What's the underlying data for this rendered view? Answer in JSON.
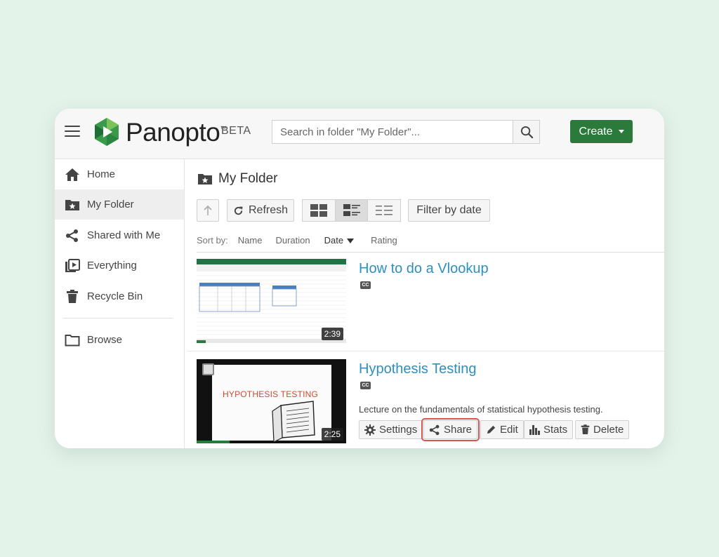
{
  "app": {
    "name": "Panopto",
    "trademark": "™",
    "badge": "BETA"
  },
  "colors": {
    "accent": "#2b7a3c",
    "link": "#2e8fbf",
    "highlight": "#d9534f"
  },
  "search": {
    "placeholder": "Search in folder \"My Folder\"..."
  },
  "header": {
    "create_label": "Create"
  },
  "sidebar": {
    "items": [
      {
        "label": "Home",
        "icon": "home-icon"
      },
      {
        "label": "My Folder",
        "icon": "starred-folder-icon",
        "active": true
      },
      {
        "label": "Shared with Me",
        "icon": "share-icon"
      },
      {
        "label": "Everything",
        "icon": "video-library-icon"
      },
      {
        "label": "Recycle Bin",
        "icon": "trash-icon"
      }
    ],
    "browse_label": "Browse"
  },
  "main": {
    "folder_title": "My Folder",
    "toolbar": {
      "refresh_label": "Refresh",
      "filter_label": "Filter by date"
    },
    "sort": {
      "label": "Sort by:",
      "options": [
        "Name",
        "Duration",
        "Date",
        "Rating"
      ],
      "active": "Date"
    }
  },
  "sessions": [
    {
      "title": "How to do a Vlookup",
      "duration": "2:39",
      "cc": "CC",
      "progress": 0.06
    },
    {
      "title": "Hypothesis Testing",
      "duration": "2:25",
      "cc": "CC",
      "progress": 0.22,
      "description": "Lecture on the fundamentals of statistical hypothesis testing.",
      "thumb_text": "HYPOTHESIS TESTING",
      "actions": {
        "settings": "Settings",
        "share": "Share",
        "edit": "Edit",
        "stats": "Stats",
        "delete": "Delete"
      }
    }
  ]
}
